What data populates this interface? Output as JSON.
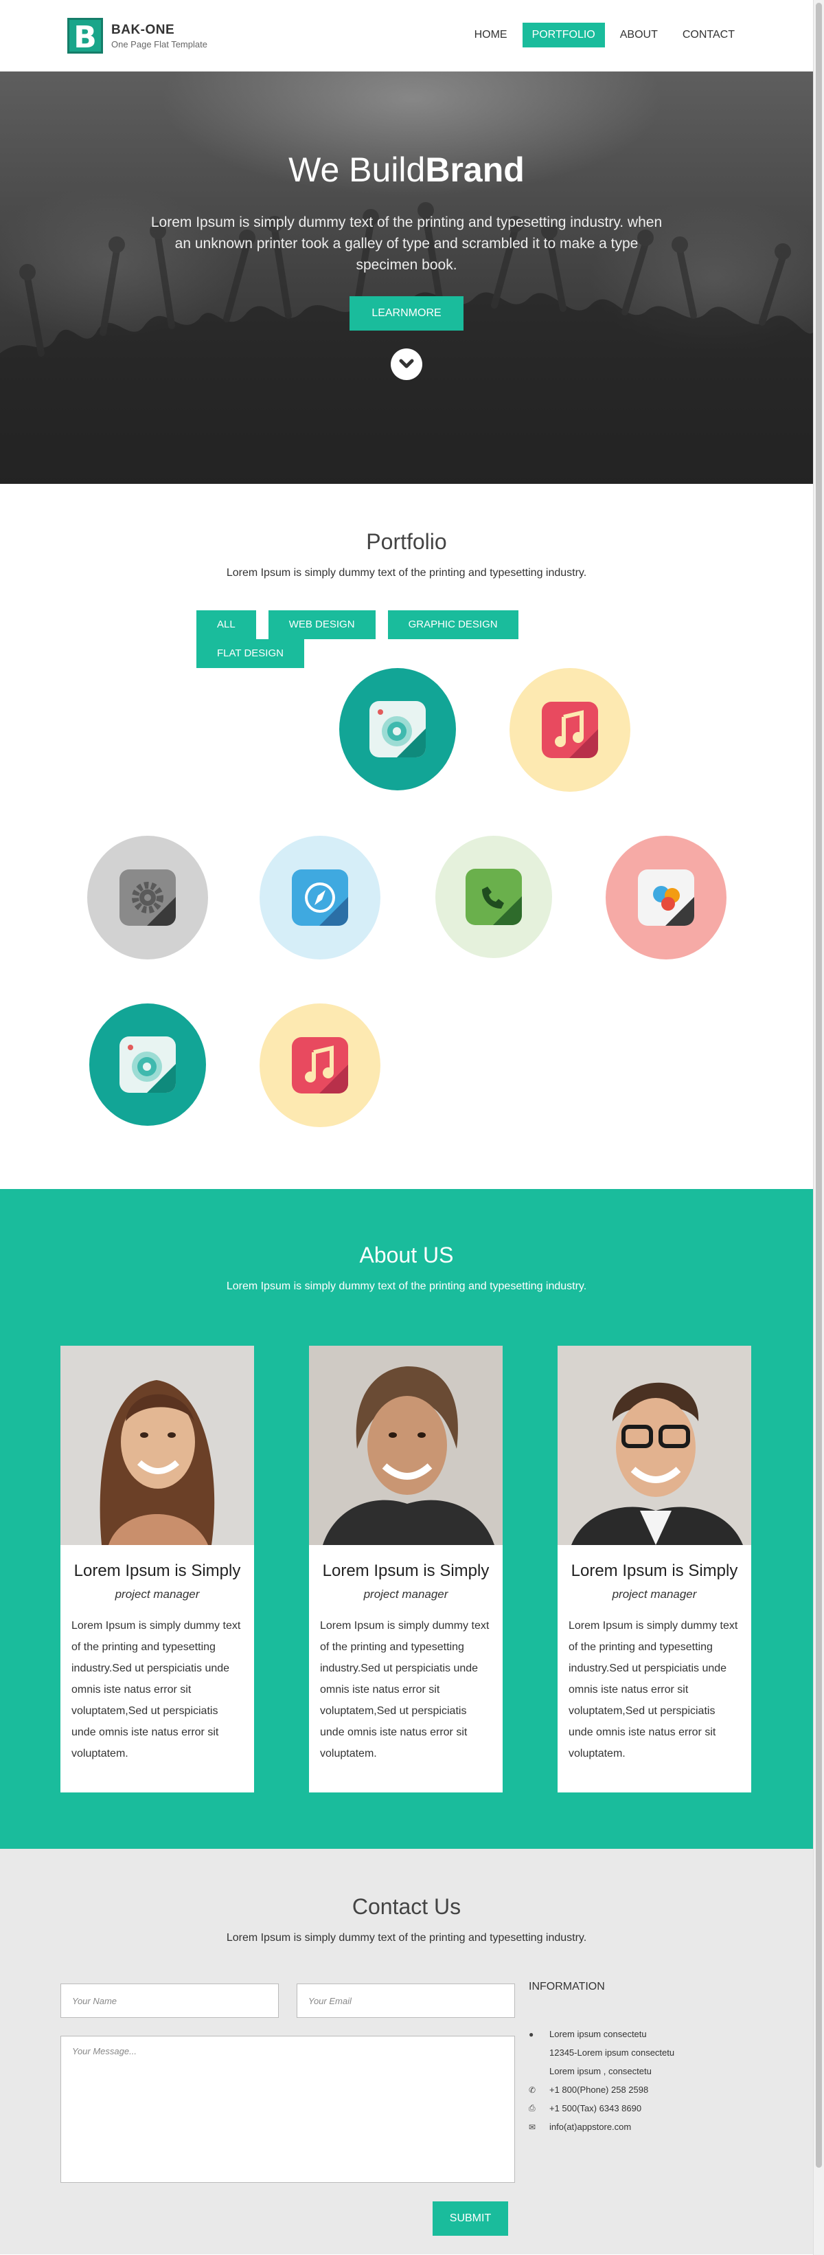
{
  "brand": {
    "letter": "B",
    "name": "BAK-ONE",
    "tagline": "One Page Flat Template"
  },
  "nav": [
    {
      "label": "HOME",
      "active": false
    },
    {
      "label": "PORTFOLIO",
      "active": true
    },
    {
      "label": "ABOUT",
      "active": false
    },
    {
      "label": "CONTACT",
      "active": false
    }
  ],
  "hero": {
    "title_light": "We Build",
    "title_bold": "Brand",
    "text": "Lorem Ipsum is simply dummy text of the printing and typesetting industry. when an unknown printer took a galley of type and scrambled it to make a type specimen book.",
    "button": "LEARNMORE",
    "scroll_icon": "chevron-down-icon"
  },
  "portfolio": {
    "title": "Portfolio",
    "subtitle": "Lorem Ipsum is simply dummy text of the printing and typesetting industry.",
    "filters": [
      "ALL",
      "WEB DESIGN",
      "GRAPHIC DESIGN",
      "FLAT DESIGN"
    ],
    "items": [
      {
        "icon": "camera-icon",
        "bg": "#12a596"
      },
      {
        "icon": "music-icon",
        "bg": "#fde9b1"
      },
      {
        "icon": "settings-icon",
        "bg": "#d2d2d2"
      },
      {
        "icon": "compass-icon",
        "bg": "#d6eef8"
      },
      {
        "icon": "phone-icon",
        "bg": "#e5f1dc"
      },
      {
        "icon": "chat-icon",
        "bg": "#f6aaa6"
      },
      {
        "icon": "camera-icon",
        "bg": "#12a596"
      },
      {
        "icon": "music-icon",
        "bg": "#fde9b1"
      }
    ]
  },
  "about": {
    "title": "About US",
    "subtitle": "Lorem Ipsum is simply dummy text of the printing and typesetting industry.",
    "members": [
      {
        "name": "Lorem Ipsum is Simply",
        "role": "project manager",
        "bio": "Lorem Ipsum is simply dummy text of the printing and typesetting industry.Sed ut perspiciatis unde omnis iste natus error sit voluptatem,Sed ut perspiciatis unde omnis iste natus error sit voluptatem."
      },
      {
        "name": "Lorem Ipsum is Simply",
        "role": "project manager",
        "bio": "Lorem Ipsum is simply dummy text of the printing and typesetting industry.Sed ut perspiciatis unde omnis iste natus error sit voluptatem,Sed ut perspiciatis unde omnis iste natus error sit voluptatem."
      },
      {
        "name": "Lorem Ipsum is Simply",
        "role": "project manager",
        "bio": "Lorem Ipsum is simply dummy text of the printing and typesetting industry.Sed ut perspiciatis unde omnis iste natus error sit voluptatem,Sed ut perspiciatis unde omnis iste natus error sit voluptatem."
      }
    ]
  },
  "contact": {
    "title": "Contact Us",
    "subtitle": "Lorem Ipsum is simply dummy text of the printing and typesetting industry.",
    "name_placeholder": "Your Name",
    "email_placeholder": "Your Email",
    "message_placeholder": "Your Message...",
    "submit": "SUBMIT",
    "info_title": "INFORMATION",
    "address": [
      "Lorem ipsum consectetu",
      "12345-Lorem ipsum consectetu",
      "Lorem ipsum , consectetu"
    ],
    "phone": "+1 800(Phone) 258 2598",
    "fax": "+1 500(Tax) 6343 8690",
    "email": "info(at)appstore.com"
  },
  "colors": {
    "accent": "#1abc9c",
    "contact_bg": "#e9e9e9"
  }
}
